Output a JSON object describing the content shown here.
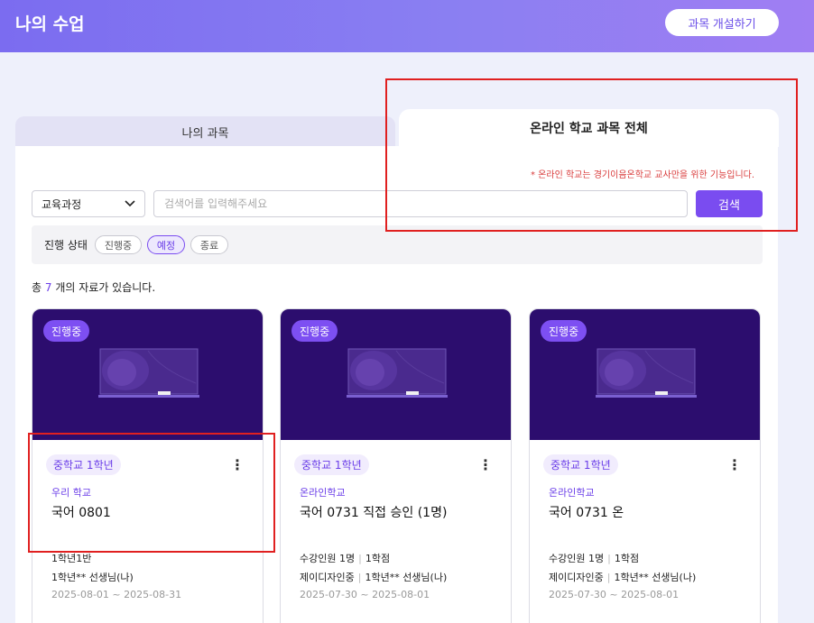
{
  "header": {
    "title": "나의 수업",
    "create_button": "과목 개설하기"
  },
  "tabs": {
    "my": "나의 과목",
    "online": "온라인 학교 과목 전체"
  },
  "notice": "* 온라인 학교는 경기이음온학교 교사만을 위한 기능입니다.",
  "search": {
    "select_value": "교육과정",
    "placeholder": "검색어를 입력해주세요",
    "button": "검색"
  },
  "status_filter": {
    "label": "진행 상태",
    "chips": [
      "진행중",
      "예정",
      "종료"
    ],
    "active": "예정"
  },
  "count": {
    "prefix": "총",
    "number": "7",
    "suffix": "개의 자료가 있습니다."
  },
  "cards": [
    {
      "badge": "진행중",
      "tag": "중학교 1학년",
      "school": "우리 학교",
      "title": "국어 0801",
      "meta1": "1학년1반",
      "meta1_b": "",
      "meta2_a": "1학년**",
      "meta2_b": "선생님(나)",
      "dates": "2025-08-01 ~ 2025-08-31"
    },
    {
      "badge": "진행중",
      "tag": "중학교 1학년",
      "school": "온라인학교",
      "title": "국어 0731 직접 승인 (1명)",
      "meta1": "수강인원 1명",
      "meta1_b": "1학점",
      "meta2_a": "제이디자인중",
      "meta2_b": "1학년** 선생님(나)",
      "dates": "2025-07-30 ~ 2025-08-01"
    },
    {
      "badge": "진행중",
      "tag": "중학교 1학년",
      "school": "온라인학교",
      "title": "국어 0731 온",
      "meta1": "수강인원 1명",
      "meta1_b": "1학점",
      "meta2_a": "제이디자인중",
      "meta2_b": "1학년** 선생님(나)",
      "dates": "2025-07-30 ~ 2025-08-01"
    }
  ],
  "colors": {
    "accent": "#7a4cf0",
    "card_image_bg": "#2c0d6e",
    "notice_red": "#d93b3b"
  }
}
